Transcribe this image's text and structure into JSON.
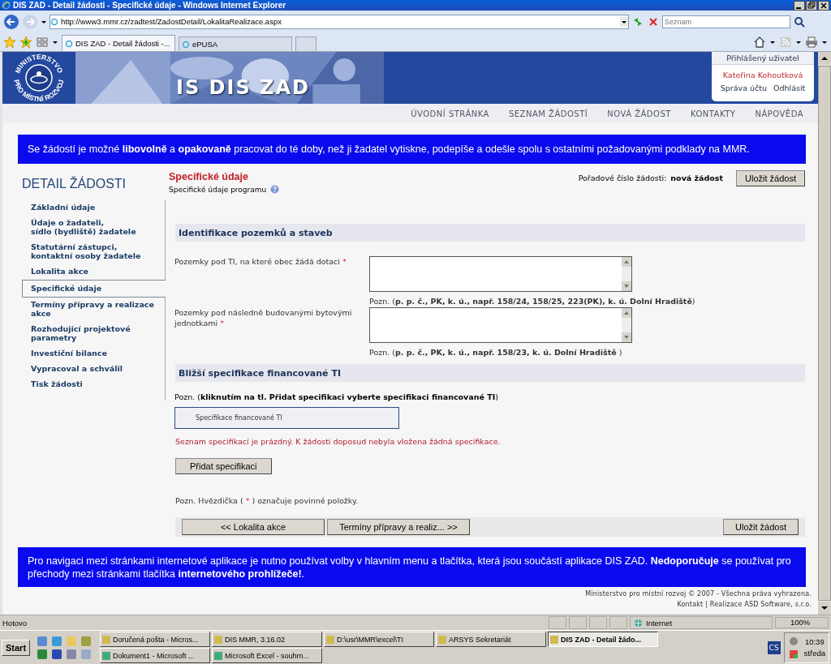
{
  "window": {
    "title": "DIS ZAD - Detail žádosti - Specifické údaje - Windows Internet Explorer"
  },
  "browser": {
    "address": "http://www3.mmr.cz/zadtest/ZadostDetail/LokalitaRealizace.aspx",
    "search_placeholder": "Seznam",
    "tabs": [
      {
        "label": "DIS ZAD - Detail žádosti -...",
        "selected": true
      },
      {
        "label": "ePUSA",
        "selected": false
      }
    ]
  },
  "header": {
    "logo_top": "MINISTERSTVO",
    "logo_bottom": "PRO MÍSTNÍ ROZVOJ",
    "title": "IS DIS ZAD",
    "user_box": {
      "heading": "Přihlášený uživatel",
      "name": "Kateřina Kohoutková",
      "links": [
        "Správa účtu",
        "Odhlásit"
      ]
    }
  },
  "nav": [
    "ÚVODNÍ STRÁNKA",
    "SEZNAM ŽÁDOSTÍ",
    "NOVÁ ŽÁDOST",
    "KONTAKTY",
    "NÁPOVĚDA"
  ],
  "notice": "Se žádostí je možné **libovolně** a **opakovaně** pracovat do té doby, než ji žadatel vytiskne, podepíše a odešle spolu s ostatními požadovanými podklady na MMR.",
  "sidebar": {
    "title": "DETAIL ŽÁDOSTI",
    "items": [
      {
        "label": "Základní údaje",
        "selected": false
      },
      {
        "label": "Údaje o žadateli,\nsídlo (bydliště) žadatele",
        "selected": false
      },
      {
        "label": "Statutární zástupci,\nkontaktní osoby žadatele",
        "selected": false
      },
      {
        "label": "Lokalita akce",
        "selected": false
      },
      {
        "label": "Specifické údaje",
        "selected": true
      },
      {
        "label": "Termíny přípravy a realizace akce",
        "selected": false
      },
      {
        "label": "Rozhodující projektové parametry",
        "selected": false
      },
      {
        "label": "Investiční bilance",
        "selected": false
      },
      {
        "label": "Vypracoval a schválil",
        "selected": false
      },
      {
        "label": "Tisk žádosti",
        "selected": false
      }
    ]
  },
  "main": {
    "title": "Specifické údaje",
    "subtitle": "Specifické údaje programu",
    "order_label": "Pořadové číslo žádosti:",
    "order_value": "nová žádost",
    "save_button": "Uložit žádost",
    "section1": {
      "heading": "Identifikace pozemků a staveb",
      "fields": [
        {
          "label": "Pozemky pod TI, na které obec žádá dotaci",
          "required_mark": "*",
          "note": "Pozn. (**p. p. č., PK, k. ú., např. 158/24, 158/25, 223(PK), k. ú. Dolní Hradiště**)"
        },
        {
          "label": "Pozemky pod následně budovanými bytovými jednotkami",
          "required_mark": "*",
          "note": "Pozn. (**p. p. č., PK, k. ú., např. 158/23, k. ú. Dolní Hradiště** )"
        }
      ]
    },
    "section2": {
      "heading": "Bližší specifikace financované TI",
      "note": "Pozn. (**kliknutím na tl. Přidat specifikaci vyberte specifikaci financované TI**)",
      "table_header": "Specifikace financované TI",
      "empty_message": "Seznam specifikací je prázdný. K žádosti doposud nebyla vložena žádná specifikace.",
      "add_button": "Přidat specifikaci"
    },
    "legend": {
      "before": "Pozn. Hvězdička (",
      "mark": "*",
      "after": ") označuje povinné položky."
    },
    "prev_button": "<<  Lokalita akce",
    "next_button": "Termíny přípravy a realiz...  >>",
    "bottom_save_button": "Uložit žádost"
  },
  "footer_notice": "Pro navigaci mezi stránkami internetové aplikace je nutno používat volby v hlavním menu a tlačítka, která jsou součástí aplikace DIS ZAD. **Nedoporučuje** se používat pro přechody mezi stránkami tlačítka **internetového prohlížeče!**.",
  "copyright": {
    "line": "Ministerstvo pro místní rozvoj © 2007 - Všechna práva vyhrazena.",
    "contact_link": "Kontakt",
    "separator": "|",
    "credit": "Realizace ASD Software, s.r.o."
  },
  "status_bar": {
    "text": "Hotovo",
    "zone": "Internet",
    "zoom": "100%"
  },
  "taskbar": {
    "start": "Start",
    "tasks": [
      {
        "label": "Doručená pošta - Micros...",
        "selected": false
      },
      {
        "label": "DIS MMR, 3.16.02",
        "selected": false
      },
      {
        "label": "D:\\usr\\MMR\\excel\\TI",
        "selected": false
      },
      {
        "label": "ARSYS Sekretariát",
        "selected": false
      },
      {
        "label": "DIS ZAD - Detail žádo...",
        "selected": true
      },
      {
        "label": "Dokument1 - Microsoft ...",
        "selected": false
      },
      {
        "label": "Microsoft Excel - souhrn...",
        "selected": false
      }
    ],
    "tray_badge": "CS",
    "time": "10:39",
    "day": "středa"
  }
}
